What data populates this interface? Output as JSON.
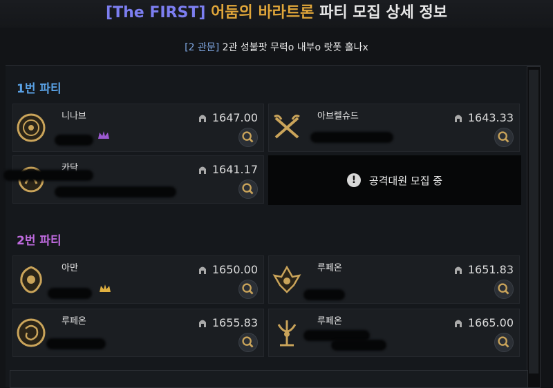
{
  "header": {
    "tag": "[The FIRST]",
    "raid": "어둠의 바라트론",
    "rest": "파티 모집 상세 정보"
  },
  "subtitle": {
    "tag": "[2 관문]",
    "text": "2관 성불팟 무력o 내부o 랏폿 홀나x"
  },
  "party1": {
    "title": "1번 파티",
    "color": "#5aa2e6",
    "slots": [
      {
        "name": "니나브",
        "ilvl": "1647.00",
        "emblem": "holyknight-emblem",
        "crown": "purple"
      },
      {
        "name": "아브렐슈드",
        "ilvl": "1643.33",
        "emblem": "berserker-emblem"
      },
      {
        "name": "카닥",
        "ilvl": "1641.17",
        "emblem": "bard-emblem"
      }
    ],
    "recruit_text": "공격대원 모집 중"
  },
  "party2": {
    "title": "2번 파티",
    "color": "#c06be0",
    "slots": [
      {
        "name": "아만",
        "ilvl": "1650.00",
        "emblem": "artist-emblem",
        "crown": "gold"
      },
      {
        "name": "루페온",
        "ilvl": "1651.83",
        "emblem": "slayer-emblem"
      },
      {
        "name": "루페온",
        "ilvl": "1655.83",
        "emblem": "destroyer-emblem"
      },
      {
        "name": "루페온",
        "ilvl": "1665.00",
        "emblem": "sorceress-emblem"
      }
    ]
  },
  "colors": {
    "tag": "#7c7ef0",
    "raid": "#e0a63a",
    "gold": "#caa45a",
    "crown_purple": "#9b59d0",
    "crown_gold": "#e0b040"
  }
}
